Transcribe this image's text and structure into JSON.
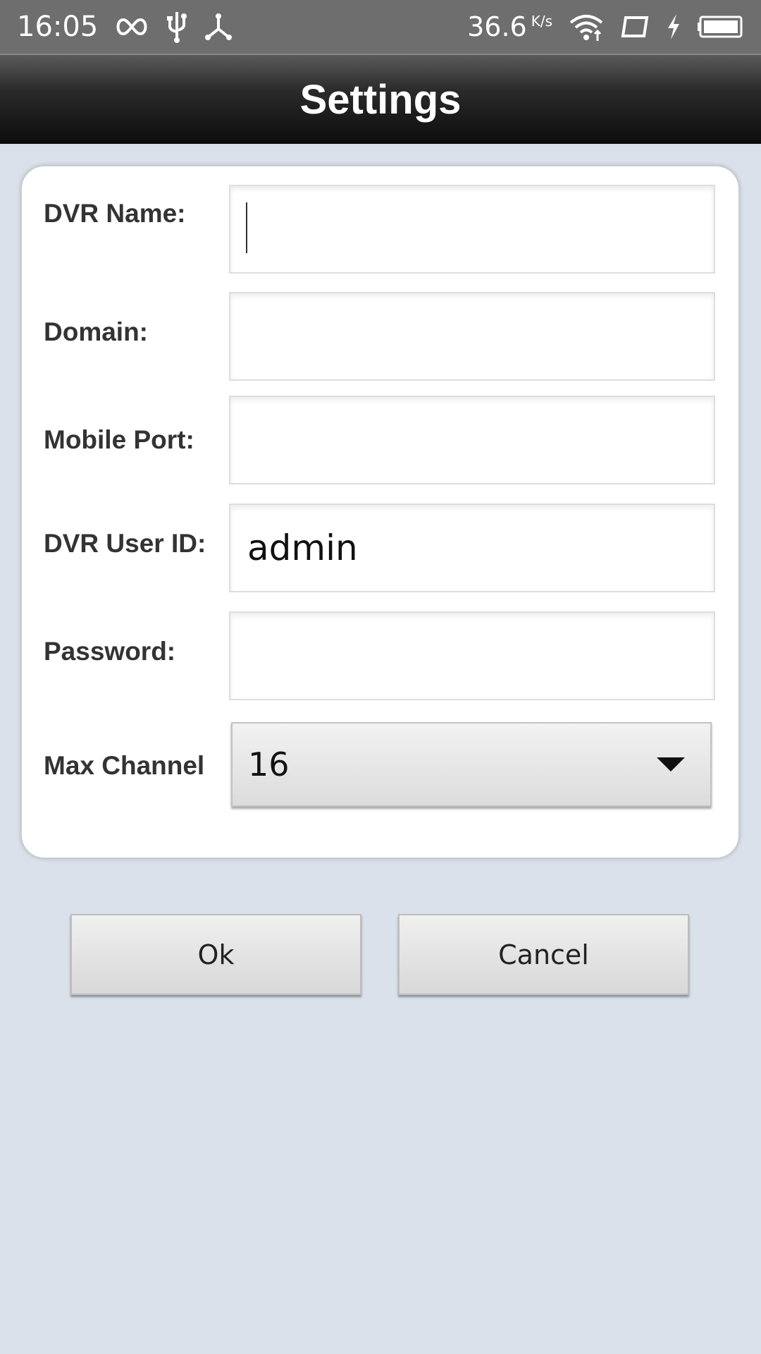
{
  "status_bar": {
    "time": "16:05",
    "network_speed": "36.6",
    "network_speed_unit": "K/s",
    "icons": [
      "infinity-icon",
      "usb-icon",
      "share-icon",
      "wifi-icon",
      "screen-icon",
      "charging-icon",
      "battery-icon"
    ]
  },
  "header": {
    "title": "Settings"
  },
  "form": {
    "dvr_name": {
      "label": "DVR Name:",
      "value": ""
    },
    "domain": {
      "label": "Domain:",
      "value": ""
    },
    "mobile_port": {
      "label": "Mobile Port:",
      "value": ""
    },
    "dvr_user_id": {
      "label": "DVR User ID:",
      "value": "admin"
    },
    "password": {
      "label": "Password:",
      "value": ""
    },
    "max_channel": {
      "label": "Max Channel",
      "selected": "16"
    }
  },
  "actions": {
    "ok_label": "Ok",
    "cancel_label": "Cancel"
  },
  "colors": {
    "background": "#dae1ea",
    "status_bar": "#6e6e6e",
    "title_bar": "#0c0c0c",
    "card": "#ffffff"
  }
}
